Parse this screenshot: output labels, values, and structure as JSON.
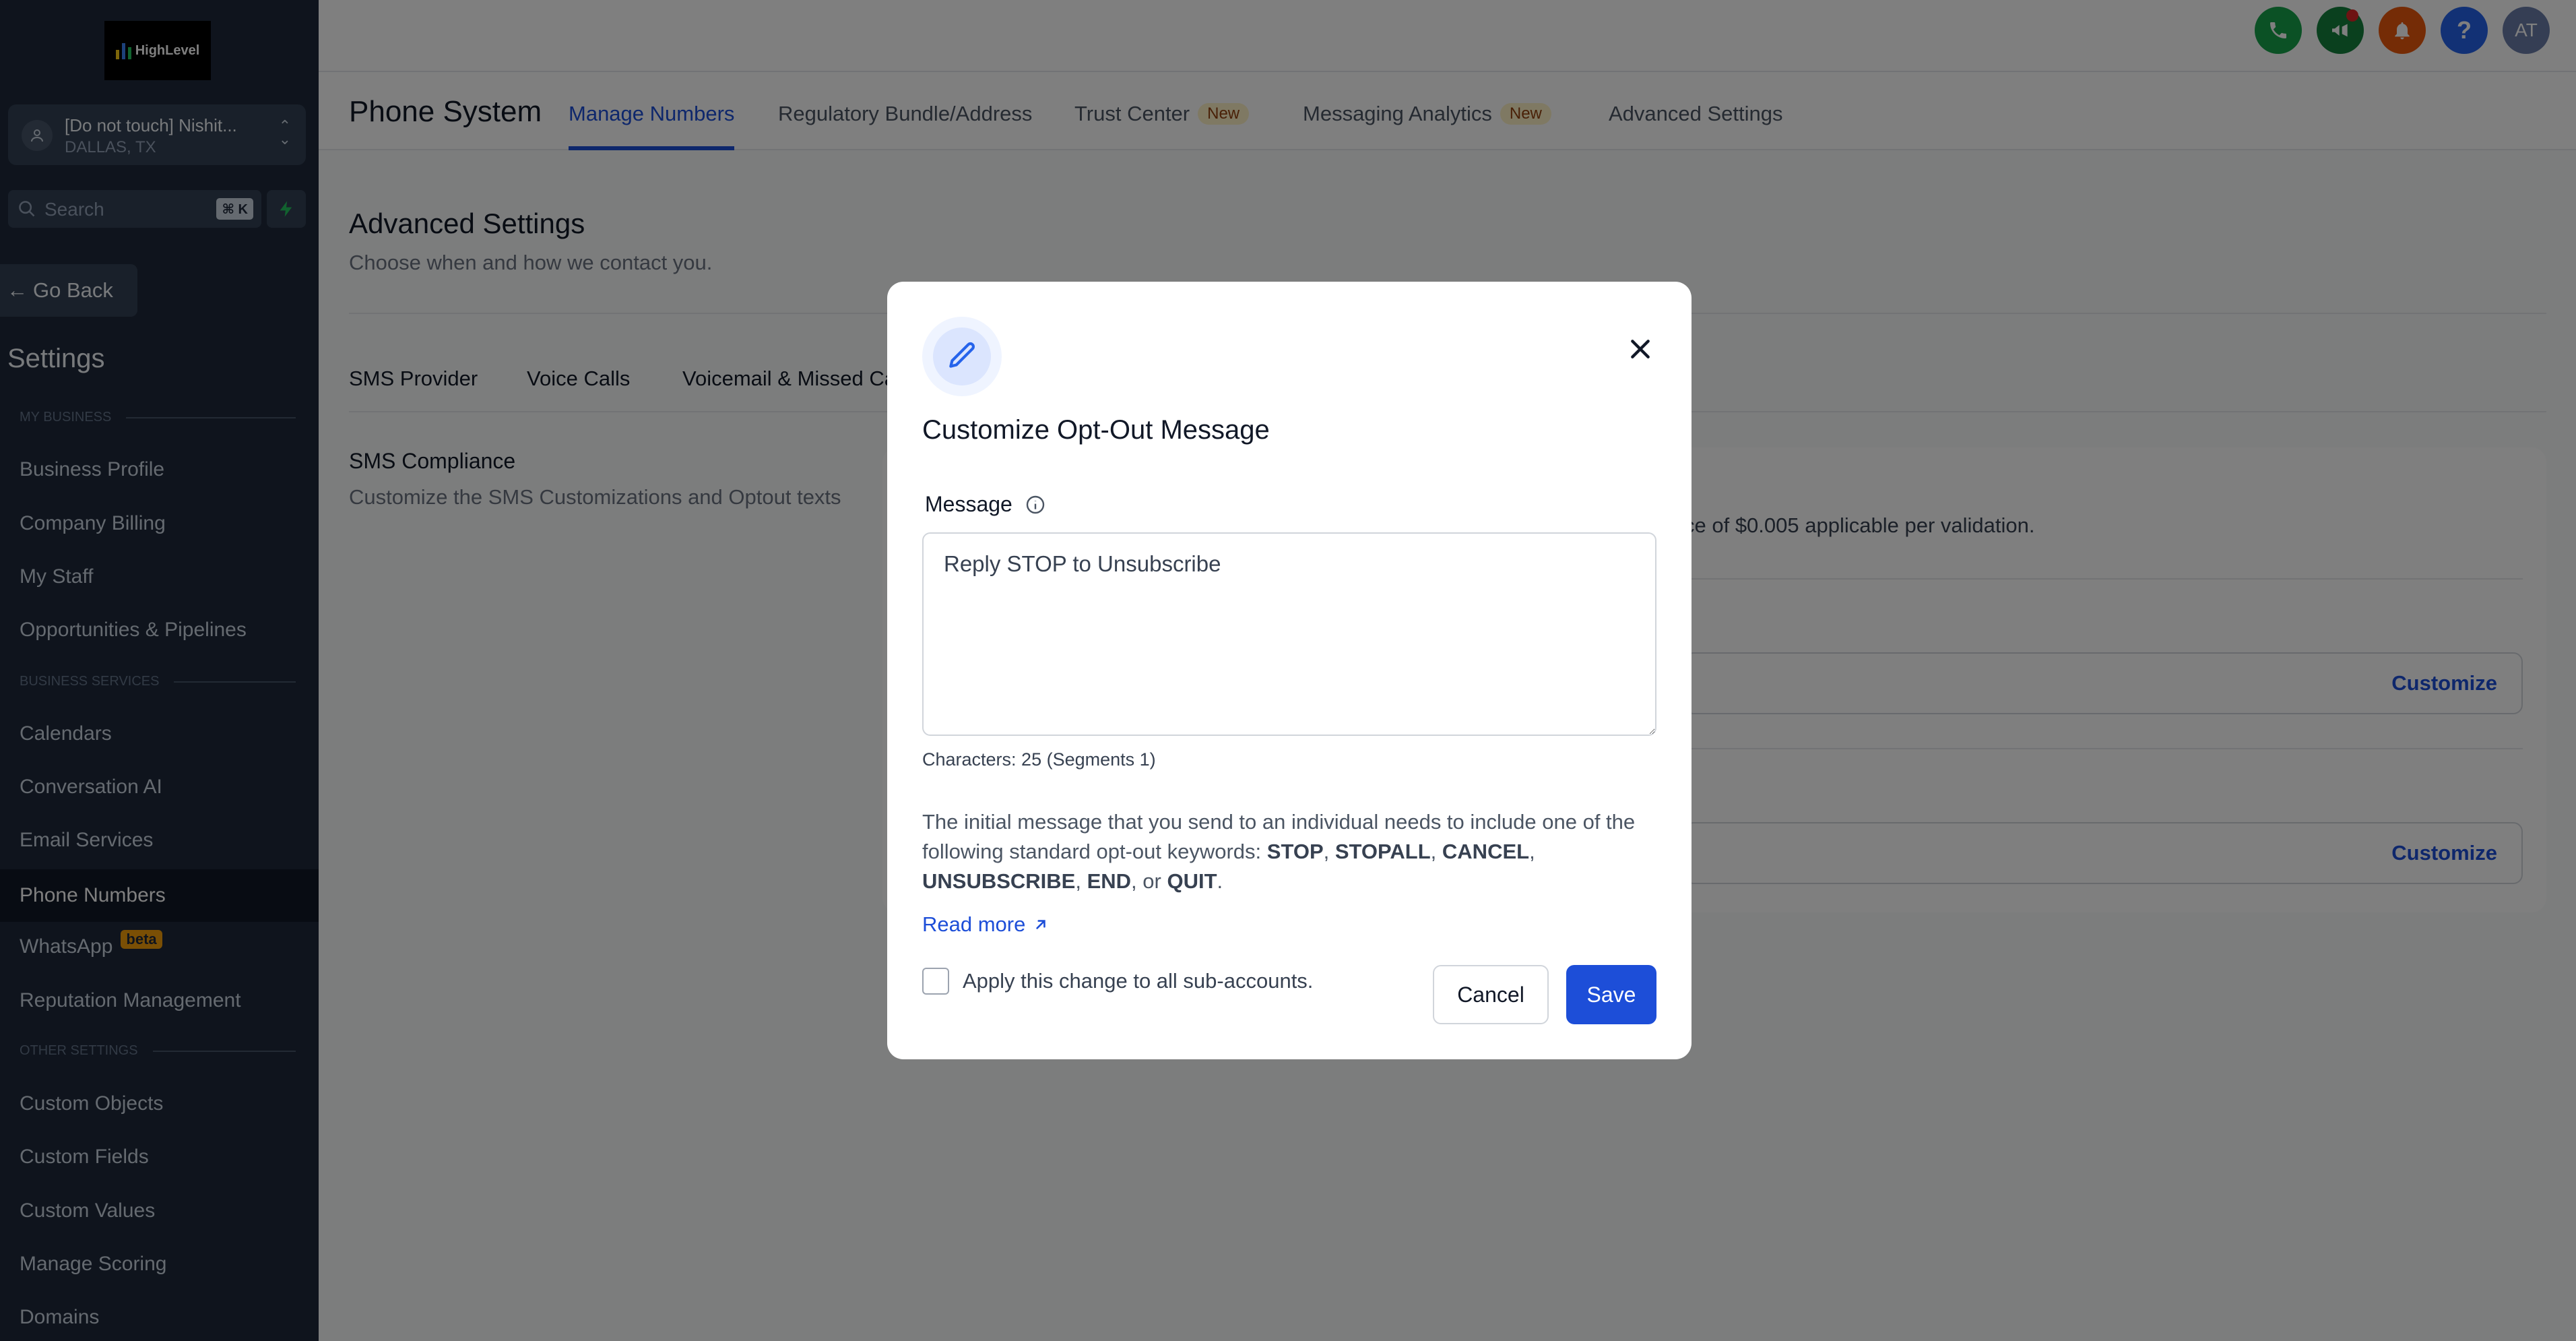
{
  "colors": {
    "sidebar_bg": "#1e293b",
    "accent": "#1d4ed8",
    "beta_badge": "#f59e0b"
  },
  "sidebar": {
    "logo_text": "HighLevel",
    "account": {
      "name": "[Do not touch] Nishit...",
      "location": "DALLAS, TX"
    },
    "search": {
      "placeholder": "Search",
      "shortcut": "⌘ K"
    },
    "go_back": "Go Back",
    "title": "Settings",
    "sections": [
      {
        "label": "MY BUSINESS",
        "items": [
          "Business Profile",
          "Company Billing",
          "My Staff",
          "Opportunities & Pipelines"
        ]
      },
      {
        "label": "BUSINESS SERVICES",
        "items": [
          "Calendars",
          "Conversation AI",
          "Email Services",
          "Phone Numbers",
          "WhatsApp",
          "Reputation Management"
        ]
      },
      {
        "label": "OTHER SETTINGS",
        "items": [
          "Custom Objects",
          "Custom Fields",
          "Custom Values",
          "Manage Scoring",
          "Domains"
        ]
      }
    ],
    "whatsapp_badge": "beta",
    "active_item": "Phone Numbers"
  },
  "topbar": {
    "icons": [
      "phone-icon",
      "megaphone-icon",
      "bell-icon",
      "help-icon",
      "avatar"
    ],
    "help_glyph": "?",
    "avatar_initials": "AT"
  },
  "header": {
    "title": "Phone System",
    "tabs": [
      {
        "label": "Manage Numbers",
        "active": true
      },
      {
        "label": "Regulatory Bundle/Address"
      },
      {
        "label": "Trust Center",
        "badge": "New"
      },
      {
        "label": "Messaging Analytics",
        "badge": "New"
      },
      {
        "label": "Advanced Settings"
      }
    ]
  },
  "content": {
    "title": "Advanced Settings",
    "subtitle": "Choose when and how we contact you.",
    "sub_tabs": [
      "SMS Provider",
      "Voice Calls",
      "Voicemail & Missed Ca"
    ],
    "section_title": "SMS Compliance",
    "section_desc": "Customize the SMS Customizations and Optout texts",
    "card_text": "ce of $0.005 applicable per validation.",
    "customize_label": "Customize"
  },
  "modal": {
    "title": "Customize Opt-Out Message",
    "message_label": "Message",
    "message_value": "Reply STOP to Unsubscribe",
    "char_count": "Characters: 25 (Segments 1)",
    "help_intro": "The initial message that you send to an individual needs to include one of the following standard opt-out keywords: ",
    "keywords": [
      "STOP",
      "STOPALL",
      "CANCEL",
      "UNSUBSCRIBE",
      "END",
      "QUIT"
    ],
    "help_or": "or",
    "read_more": "Read more",
    "apply_all_label": "Apply this change to all sub-accounts.",
    "cancel_label": "Cancel",
    "save_label": "Save"
  }
}
